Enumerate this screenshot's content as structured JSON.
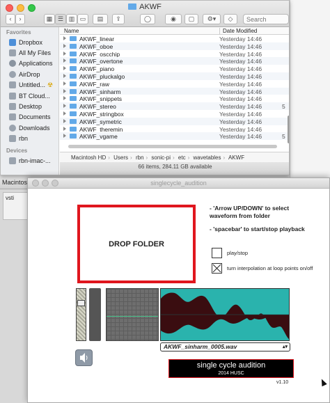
{
  "finder": {
    "title": "AKWF",
    "search_placeholder": "Search",
    "sidebar_header": "Favorites",
    "sidebar_items": [
      "Dropbox",
      "All My Files",
      "Applications",
      "AirDrop",
      "Untitled...",
      "BT Cloud...",
      "Desktop",
      "Documents",
      "Downloads",
      "rbn"
    ],
    "devices_header": "Devices",
    "devices": [
      "rbn-imac-..."
    ],
    "columns": {
      "name": "Name",
      "date": "Date Modified"
    },
    "rows": [
      {
        "name": "AKWF_linear",
        "date": "Yesterday 14:46",
        "size": ""
      },
      {
        "name": "AKWF_oboe",
        "date": "Yesterday 14:46",
        "size": ""
      },
      {
        "name": "AKWF_oscchip",
        "date": "Yesterday 14:46",
        "size": ""
      },
      {
        "name": "AKWF_overtone",
        "date": "Yesterday 14:46",
        "size": ""
      },
      {
        "name": "AKWF_piano",
        "date": "Yesterday 14:46",
        "size": ""
      },
      {
        "name": "AKWF_pluckalgo",
        "date": "Yesterday 14:46",
        "size": ""
      },
      {
        "name": "AKWF_raw",
        "date": "Yesterday 14:46",
        "size": ""
      },
      {
        "name": "AKWF_sinharm",
        "date": "Yesterday 14:46",
        "size": ""
      },
      {
        "name": "AKWF_snippets",
        "date": "Yesterday 14:46",
        "size": ""
      },
      {
        "name": "AKWF_stereo",
        "date": "Yesterday 14:46",
        "size": "5"
      },
      {
        "name": "AKWF_stringbox",
        "date": "Yesterday 14:46",
        "size": ""
      },
      {
        "name": "AKWF_symetric",
        "date": "Yesterday 14:46",
        "size": ""
      },
      {
        "name": "AKWF_theremin",
        "date": "Yesterday 14:46",
        "size": ""
      },
      {
        "name": "AKWF_vgame",
        "date": "Yesterday 14:46",
        "size": "5"
      }
    ],
    "path": [
      "Macintosh HD",
      "Users",
      "rbn",
      "sonic-pi",
      "etc",
      "wavetables",
      "AKWF"
    ],
    "status": "66 items, 284.11 GB available"
  },
  "background": {
    "left_title": "Macintosl",
    "left_item": "vsti"
  },
  "patch": {
    "title": "singlecycle_audition",
    "drop_label": "DROP FOLDER",
    "instruction1": "- 'Arrow UP/DOWN' to select waveform from folder",
    "instruction2": "- 'spacebar' to start/stop playback",
    "play_label": "play/stop",
    "interp_label": "turn interpolation at loop points on/off",
    "selected_file": "AKWF_sinharm_0005.wav",
    "brand_title": "single cycle audition",
    "brand_sub": "2014 HUSC",
    "version": "v1.10",
    "colors": {
      "accent": "#e0161e",
      "wave_bg": "#2ab3ad",
      "wave_fill": "#3a0d10"
    }
  }
}
